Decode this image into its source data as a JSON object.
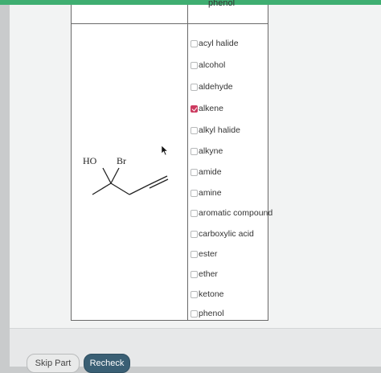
{
  "table": {
    "header_partial": "phenol"
  },
  "molecule": {
    "labels": {
      "hydroxyl": "HO",
      "bromo": "Br"
    }
  },
  "options": [
    {
      "label": "acyl halide",
      "checked": false
    },
    {
      "label": "alcohol",
      "checked": false
    },
    {
      "label": "aldehyde",
      "checked": false
    },
    {
      "label": "alkene",
      "checked": true
    },
    {
      "label": "alkyl halide",
      "checked": false
    },
    {
      "label": "alkyne",
      "checked": false
    },
    {
      "label": "amide",
      "checked": false
    },
    {
      "label": "amine",
      "checked": false
    },
    {
      "label": "aromatic compound",
      "checked": false
    },
    {
      "label": "carboxylic acid",
      "checked": false
    },
    {
      "label": "ester",
      "checked": false
    },
    {
      "label": "ether",
      "checked": false
    },
    {
      "label": "ketone",
      "checked": false
    },
    {
      "label": "phenol",
      "checked": false
    }
  ],
  "footer": {
    "skip_label": "Skip Part",
    "recheck_label": "Recheck"
  },
  "colors": {
    "accent_green": "#3fae71",
    "checked_pink": "#cc3b60",
    "recheck_button": "#3a5f74"
  }
}
